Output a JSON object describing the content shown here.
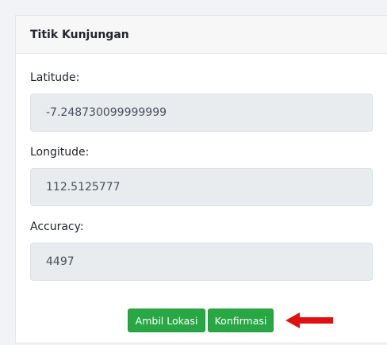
{
  "card": {
    "title": "Titik Kunjungan"
  },
  "fields": {
    "latitude": {
      "label": "Latitude:",
      "value": "-7.248730099999999"
    },
    "longitude": {
      "label": "Longitude:",
      "value": "112.5125777"
    },
    "accuracy": {
      "label": "Accuracy:",
      "value": "4497"
    }
  },
  "actions": {
    "get_location_label": "Ambil Lokasi",
    "confirm_label": "Konfirmasi",
    "button_color": "#28a745"
  },
  "annotation": {
    "arrow_icon": "red-arrow-left-icon",
    "arrow_color": "#e01010"
  }
}
